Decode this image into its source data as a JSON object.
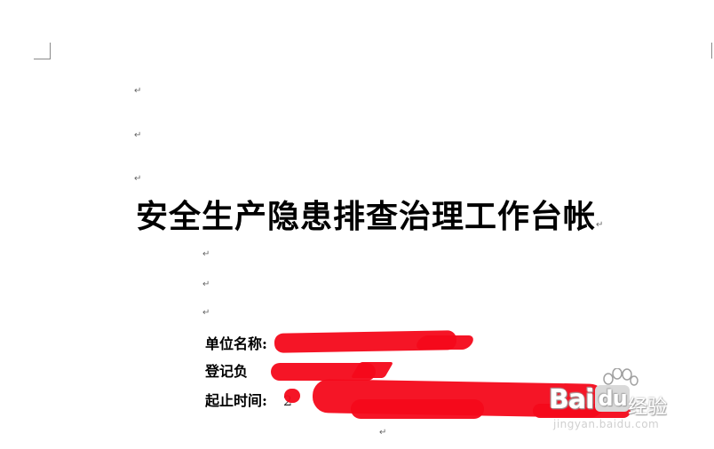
{
  "document": {
    "paragraph_mark": "↵",
    "title": "安全生产隐患排查治理工作台帐",
    "fields": [
      {
        "label": "单位名称:",
        "value": ""
      },
      {
        "label": "登记负",
        "value": ""
      },
      {
        "label": "起止时间:",
        "value": "2"
      }
    ],
    "redaction_color": "#f4081a"
  },
  "watermark": {
    "logo_bai": "Bai",
    "logo_du": "du",
    "logo_jingyan": "经验",
    "url": "jingyan.baidu.com"
  }
}
